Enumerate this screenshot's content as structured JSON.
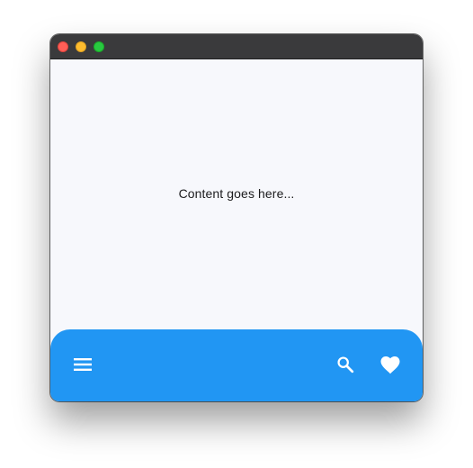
{
  "window": {
    "controls": [
      "close",
      "minimize",
      "zoom"
    ]
  },
  "content": {
    "text": "Content goes here..."
  },
  "bottom_bar": {
    "color": "#2196f3",
    "left_icon": "menu-icon",
    "right_icons": [
      "search-icon",
      "favorite-icon"
    ]
  }
}
